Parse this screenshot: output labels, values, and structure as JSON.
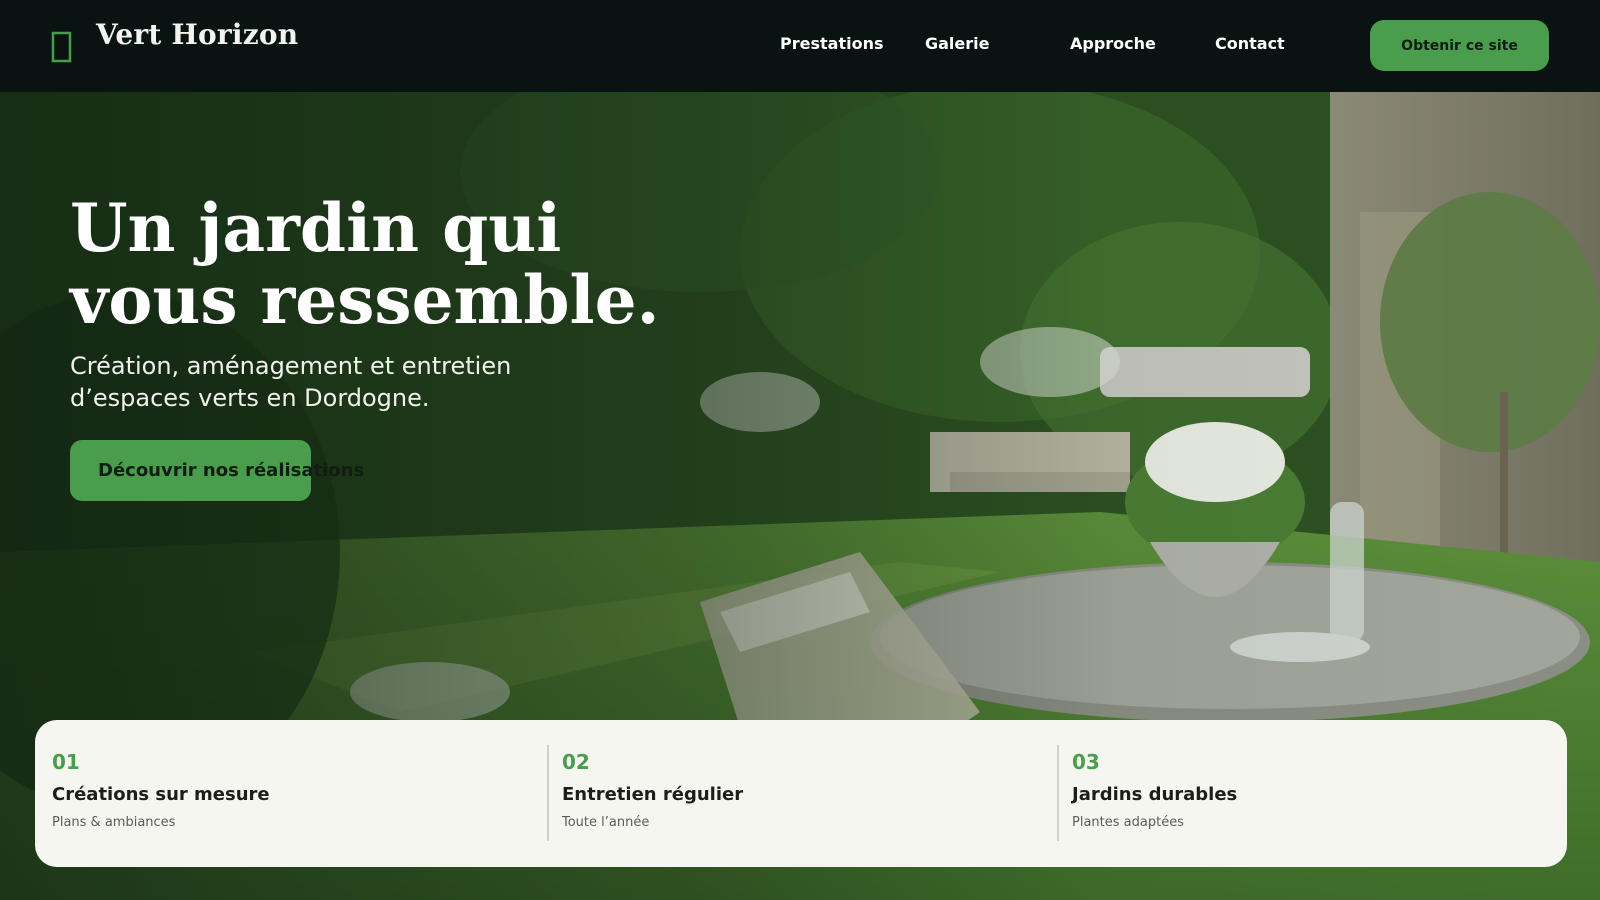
{
  "header": {
    "brand": "Vert Horizon",
    "logo_icon": "leaf-icon",
    "nav": [
      {
        "label": "Prestations"
      },
      {
        "label": "Galerie"
      },
      {
        "label": "Approche"
      },
      {
        "label": "Contact"
      }
    ],
    "cta_label": "Obtenir ce site"
  },
  "hero": {
    "title": "Un jardin qui vous ressemble.",
    "subtitle": "Création, aménagement et entretien d’espaces verts en Dordogne.",
    "cta_label": "Découvrir nos réalisations"
  },
  "features": [
    {
      "number": "01",
      "title": "Créations sur mesure",
      "desc": "Plans & ambiances"
    },
    {
      "number": "02",
      "title": "Entretien régulier",
      "desc": "Toute l’année"
    },
    {
      "number": "03",
      "title": "Jardins durables",
      "desc": "Plantes adaptées"
    }
  ],
  "colors": {
    "accent": "#4a9d4c",
    "header_bg": "#091312",
    "card_bg": "#f6f6f1"
  }
}
